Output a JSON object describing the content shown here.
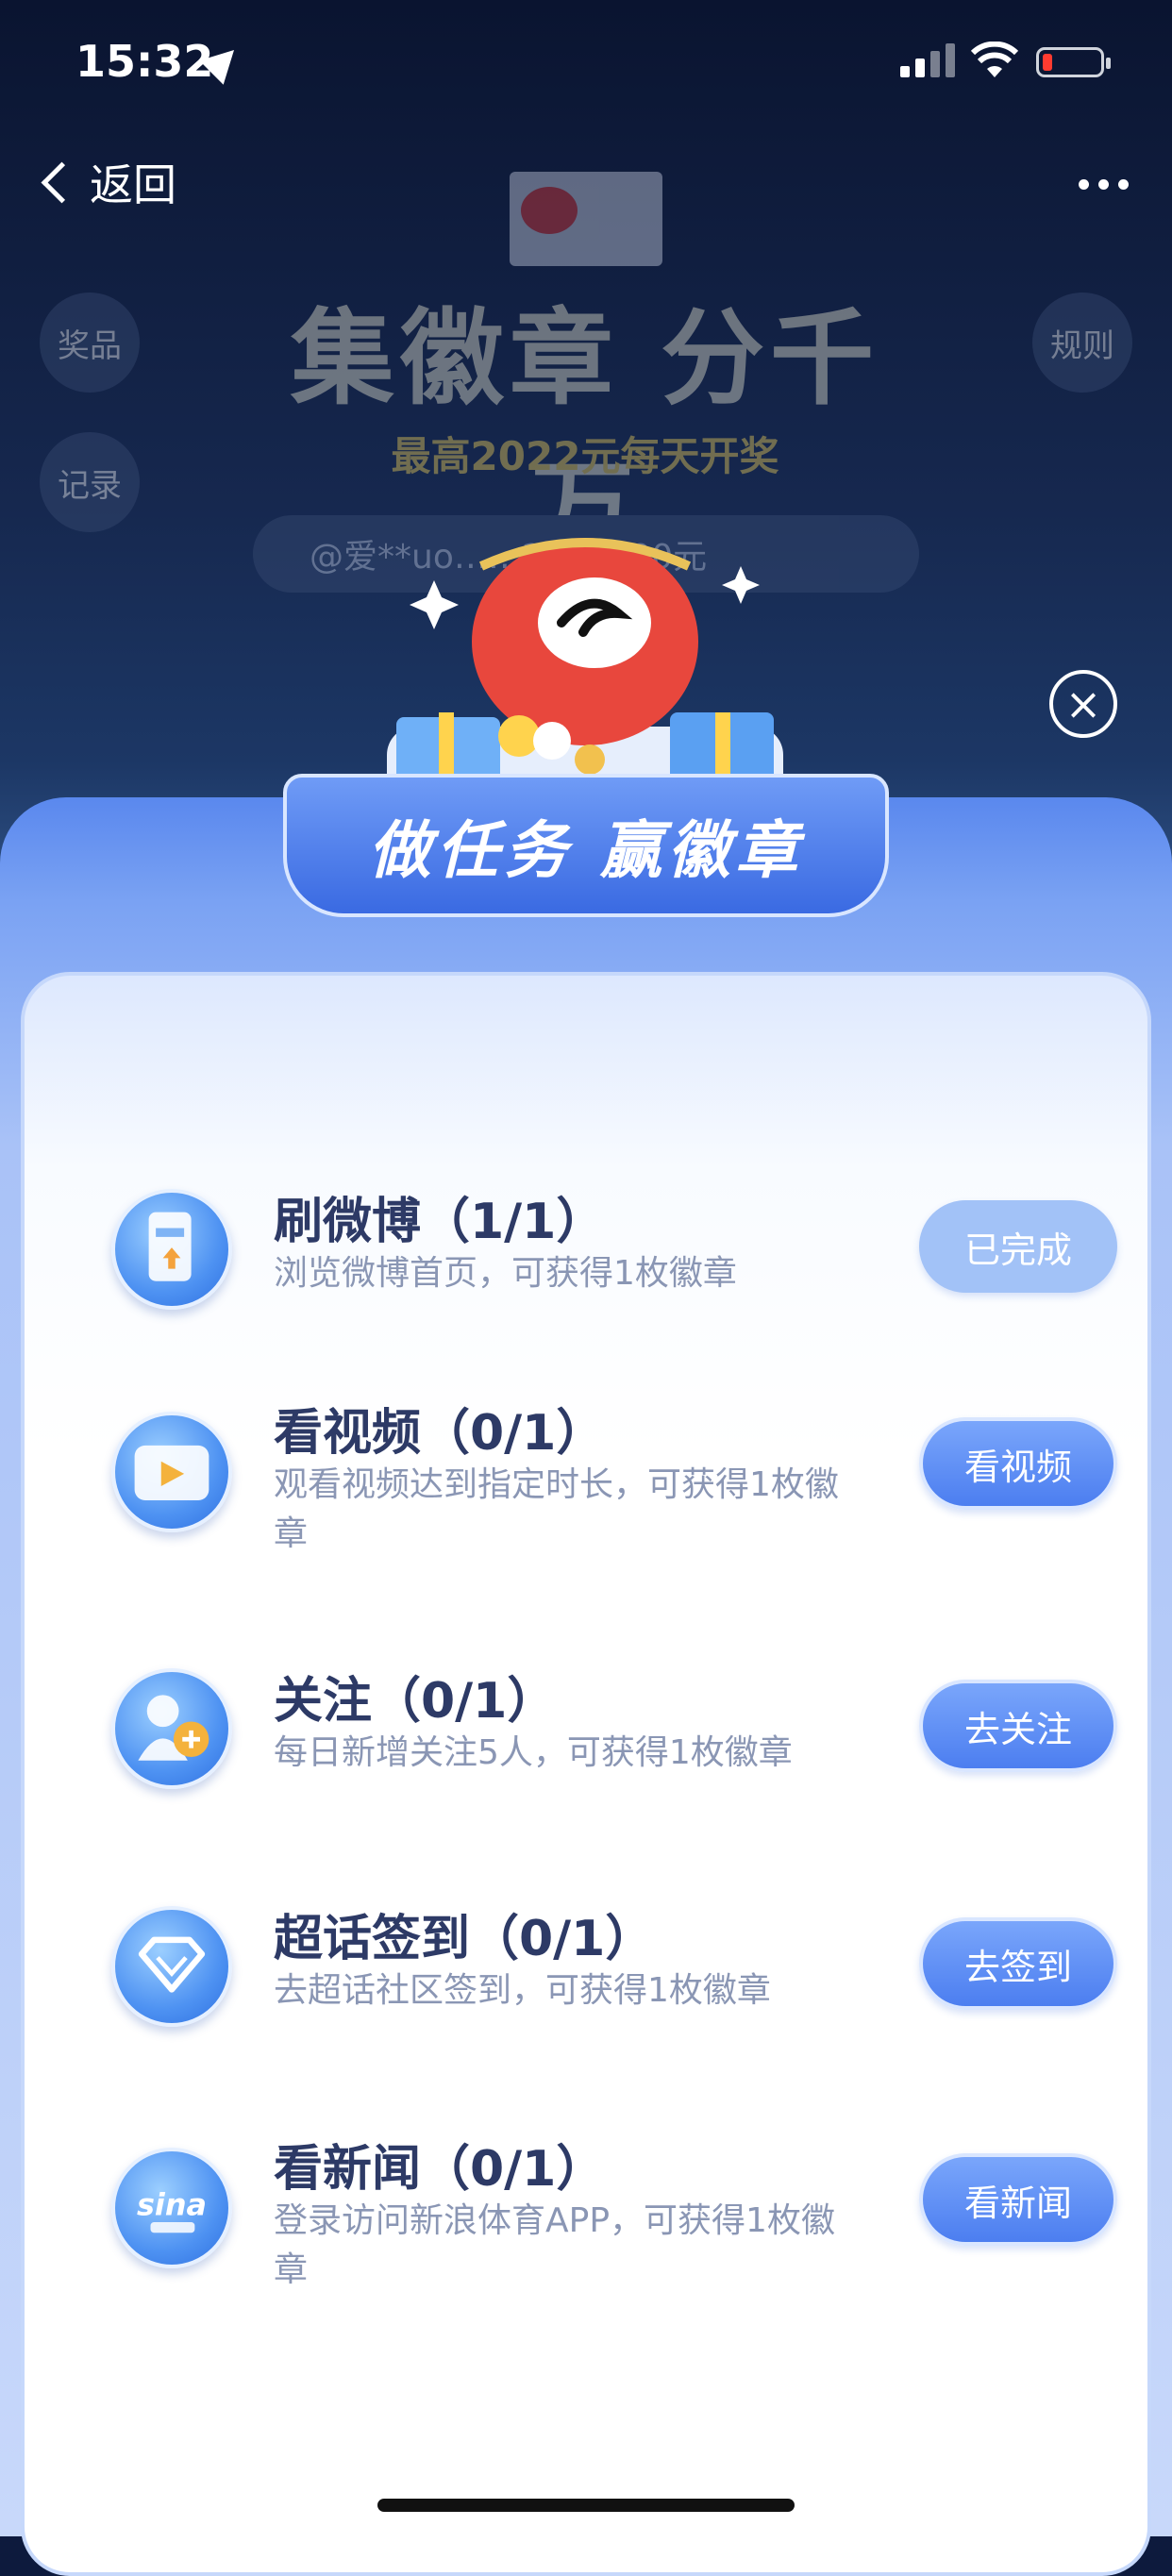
{
  "status_bar": {
    "time": "15:32"
  },
  "nav": {
    "back_label": "返回"
  },
  "background": {
    "side_buttons": {
      "prizes": "奖品",
      "records": "记录",
      "rules": "规则"
    },
    "title": "集徽章 分千万",
    "subtitle": "最高2022元每天开奖",
    "marquee": "@爱**uo……2,022.00元"
  },
  "panel": {
    "ribbon_title": "做任务 赢徽章",
    "tasks": [
      {
        "title": "刷微博（1/1）",
        "desc": "浏览微博首页，可获得1枚徽章",
        "button": "已完成",
        "icon": "phone-icon",
        "state": "done"
      },
      {
        "title": "看视频（0/1）",
        "desc": "观看视频达到指定时长，可获得1枚徽章",
        "button": "看视频",
        "icon": "tv-icon",
        "state": "todo"
      },
      {
        "title": "关注（0/1）",
        "desc": "每日新增关注5人，可获得1枚徽章",
        "button": "去关注",
        "icon": "add-follow-icon",
        "state": "todo"
      },
      {
        "title": "超话签到（0/1）",
        "desc": "去超话社区签到，可获得1枚徽章",
        "button": "去签到",
        "icon": "diamond-icon",
        "state": "todo"
      },
      {
        "title": "看新闻（0/1）",
        "desc": "登录访问新浪体育APP，可获得1枚徽章",
        "button": "看新闻",
        "icon": "sina-sports-icon",
        "state": "todo"
      }
    ]
  }
}
